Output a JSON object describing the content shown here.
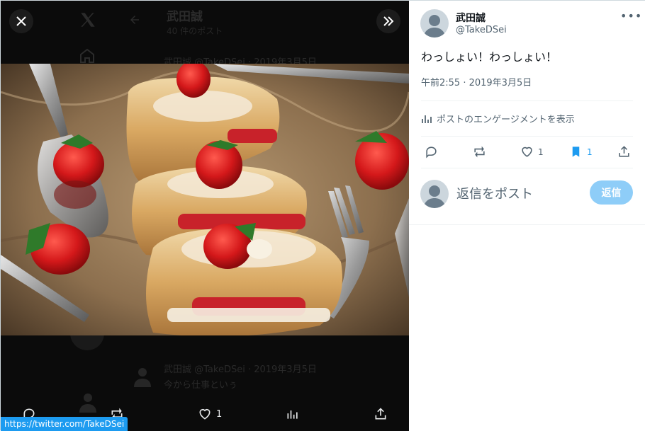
{
  "viewer": {
    "ghost": {
      "title": "武田誠",
      "post_count": "40 件のポスト",
      "row1": "武田誠 @TakeDSei · 2019年3月5日",
      "row2": "武田誠 @TakeDSei · 2019年3月5日",
      "row2_text": "今から仕事といぅ"
    },
    "photo_alt": "strawberry cream puffs on parchment with forks",
    "actions": {
      "like_count": "1"
    },
    "status_url": "https://twitter.com/TakeDSei"
  },
  "tweet": {
    "author_name": "武田誠",
    "author_handle": "@TakeDSei",
    "text": "わっしょい！わっしょい！",
    "timestamp": "午前2:55 · 2019年3月5日",
    "engagement_link": "ポストのエンゲージメントを表示",
    "like_count": "1",
    "bookmark_count": "1"
  },
  "reply": {
    "placeholder": "返信をポスト",
    "button": "返信"
  },
  "colors": {
    "accent": "#1d9bf0",
    "reply_button_disabled": "#8ecdf8",
    "text_primary": "#0f1419",
    "text_secondary": "#536471"
  }
}
